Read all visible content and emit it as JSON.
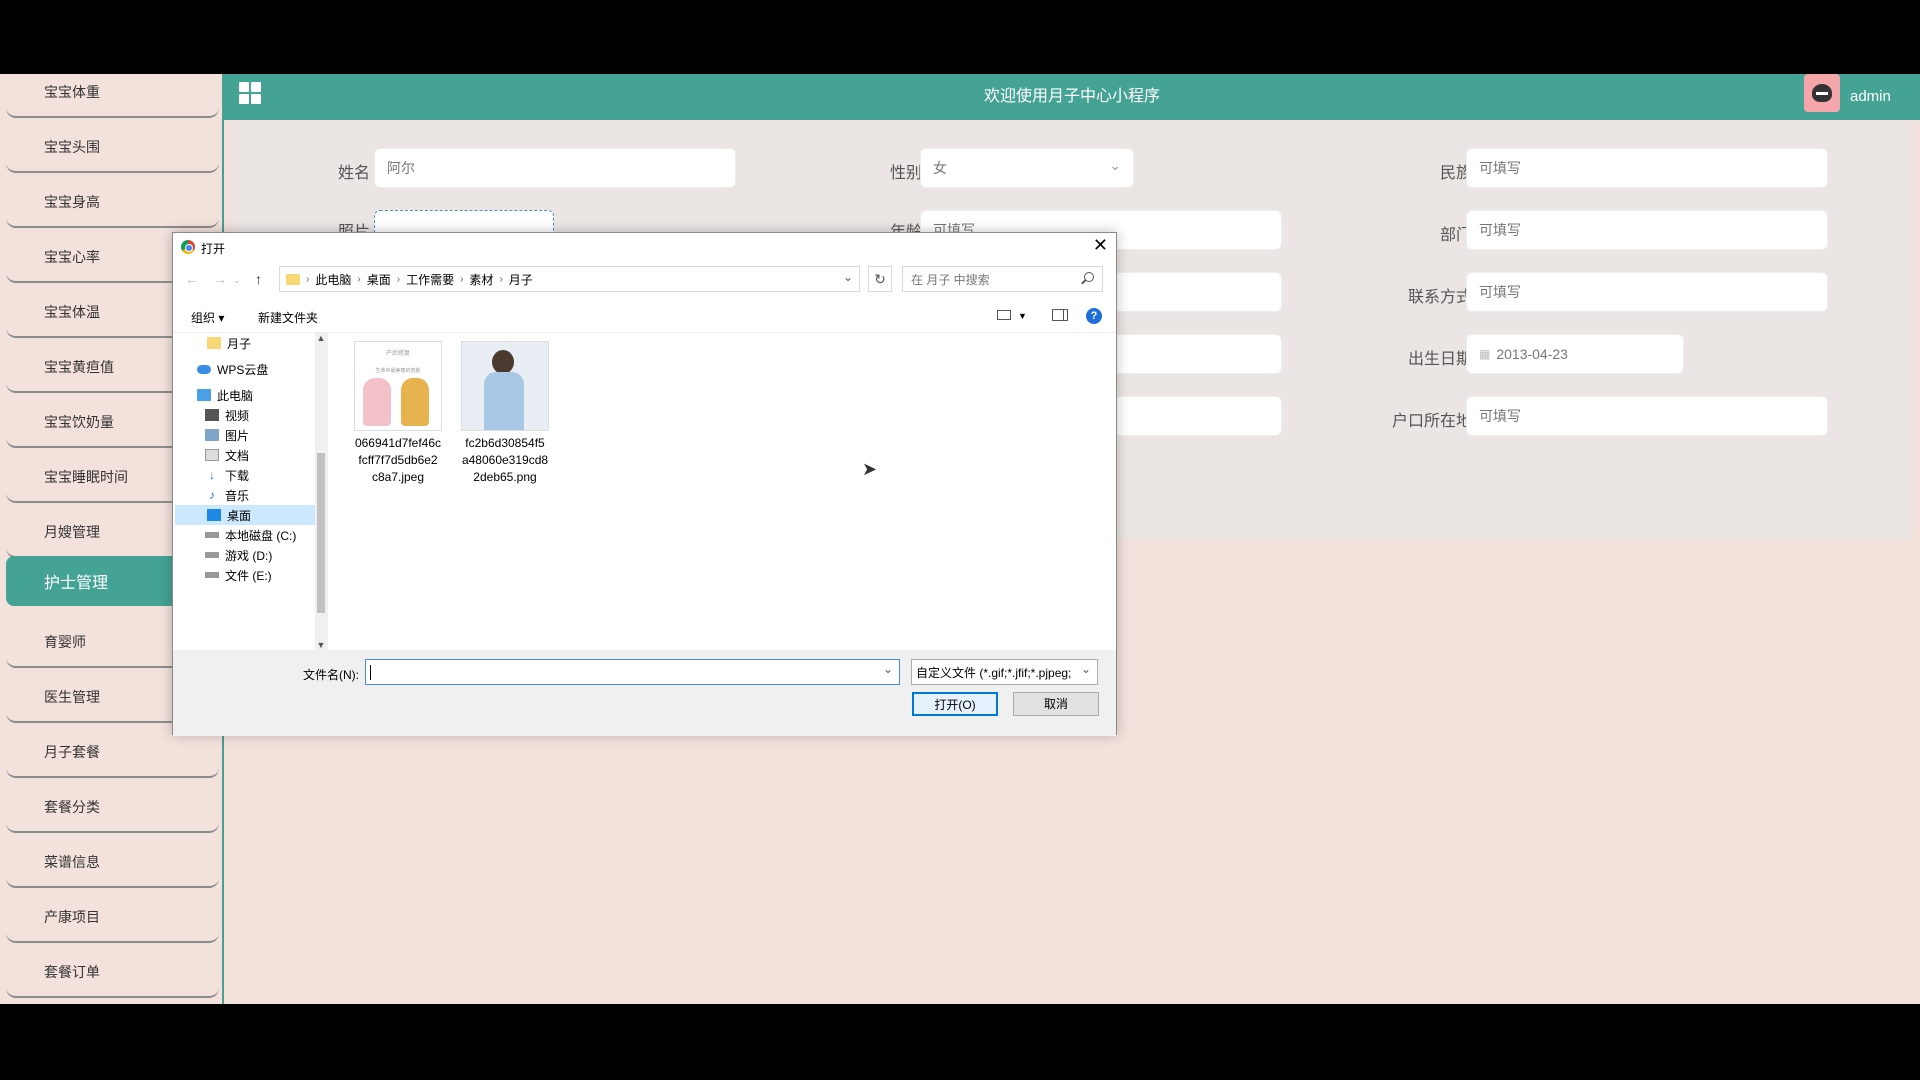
{
  "sidebar": {
    "items": [
      {
        "label": "宝宝体重"
      },
      {
        "label": "宝宝头围"
      },
      {
        "label": "宝宝身高"
      },
      {
        "label": "宝宝心率"
      },
      {
        "label": "宝宝体温"
      },
      {
        "label": "宝宝黄疸值"
      },
      {
        "label": "宝宝饮奶量"
      },
      {
        "label": "宝宝睡眠时间"
      },
      {
        "label": "月嫂管理"
      },
      {
        "label": "护士管理",
        "active": true
      },
      {
        "label": "育婴师"
      },
      {
        "label": "医生管理"
      },
      {
        "label": "月子套餐"
      },
      {
        "label": "套餐分类"
      },
      {
        "label": "菜谱信息"
      },
      {
        "label": "产康项目"
      },
      {
        "label": "套餐订单"
      }
    ]
  },
  "header": {
    "title": "欢迎使用月子中心小程序",
    "user": "admin"
  },
  "form": {
    "name_label": "姓名",
    "name_value": "阿尔",
    "gender_label": "性别",
    "gender_value": "女",
    "ethnic_label": "民族",
    "ethnic_placeholder": "可填写",
    "photo_label": "照片",
    "age_label": "年龄",
    "age_placeholder": "可填写",
    "dept_label": "部门",
    "dept_placeholder": "可填写",
    "contact_label": "联系方式",
    "contact_placeholder": "可填写",
    "birth_label": "出生日期",
    "birth_value": "2013-04-23",
    "hukou_label": "户口所在地",
    "hukou_placeholder": "可填写"
  },
  "dialog": {
    "title": "打开",
    "breadcrumb": [
      "此电脑",
      "桌面",
      "工作需要",
      "素材",
      "月子"
    ],
    "search_placeholder": "在 月子 中搜索",
    "organize": "组织 ▾",
    "new_folder": "新建文件夹",
    "help": "?",
    "nav_items": [
      {
        "label": "月子",
        "icon": "folder-icon"
      },
      {
        "label": "WPS云盘",
        "icon": "cloud-icon"
      },
      {
        "label": "此电脑",
        "icon": "computer-icon"
      },
      {
        "label": "视频",
        "icon": "video-icon"
      },
      {
        "label": "图片",
        "icon": "picture-icon"
      },
      {
        "label": "文档",
        "icon": "document-icon"
      },
      {
        "label": "下载",
        "icon": "download-icon"
      },
      {
        "label": "音乐",
        "icon": "music-icon"
      },
      {
        "label": "桌面",
        "icon": "desktop-icon",
        "selected": true
      },
      {
        "label": "本地磁盘 (C:)",
        "icon": "drive-icon"
      },
      {
        "label": "游戏 (D:)",
        "icon": "drive-icon"
      },
      {
        "label": "文件 (E:)",
        "icon": "drive-icon"
      }
    ],
    "files": [
      {
        "name_lines": [
          "066941d7fef46c",
          "fcff7f7d5db6e2",
          "c8a7.jpeg"
        ],
        "thumb_text": [
          "产后修复",
          "生命中最美丽的容颜"
        ]
      },
      {
        "name_lines": [
          "fc2b6d30854f5",
          "a48060e319cd8",
          "2deb65.png"
        ]
      }
    ],
    "filename_label": "文件名(N):",
    "filetype": "自定义文件 (*.gif;*.jfif;*.pjpeg;",
    "open_button": "打开(O)",
    "cancel_button": "取消"
  },
  "colors": {
    "accent": "#44a394",
    "background": "#f3e1dc"
  }
}
